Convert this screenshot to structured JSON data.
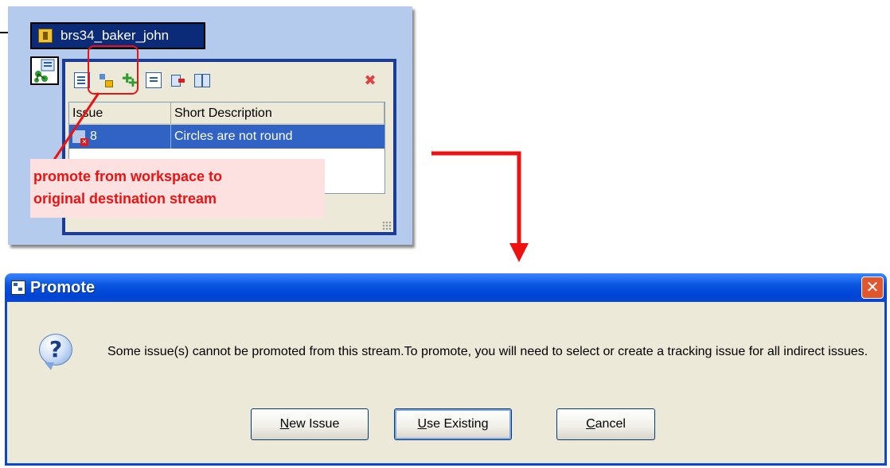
{
  "workspace": {
    "name": "brs34_baker_john",
    "icons": [
      "user-folder-icon",
      "stream-icon"
    ]
  },
  "issue_panel": {
    "toolbar": {
      "buttons": [
        {
          "name": "properties-icon"
        },
        {
          "name": "promote-icon"
        },
        {
          "name": "add-issues-icon"
        },
        {
          "name": "issue-list-icon"
        },
        {
          "name": "remove-issue-icon"
        },
        {
          "name": "compare-icon"
        },
        {
          "name": "close-icon"
        }
      ]
    },
    "table": {
      "columns": [
        "Issue",
        "Short Description"
      ],
      "rows": [
        {
          "issue": "8",
          "description": "Circles are not round",
          "selected": true
        }
      ]
    }
  },
  "annotation": {
    "callout_text": [
      "promote from workspace to",
      "original destination stream"
    ],
    "color": "#ee1111"
  },
  "dialog": {
    "title": "Promote",
    "message": "Some issue(s) cannot be promoted from this stream.To promote, you will need to select or create a tracking issue for all indirect issues.",
    "buttons": {
      "new_issue": {
        "prefix": "",
        "accel": "N",
        "rest": "ew Issue"
      },
      "use_existing": {
        "prefix": "",
        "accel": "U",
        "rest": "se Existing"
      },
      "cancel": {
        "prefix": "",
        "accel": "C",
        "rest": "ancel"
      }
    },
    "colors": {
      "titlebar": "#0a55e0",
      "body": "#ece9d8"
    }
  }
}
